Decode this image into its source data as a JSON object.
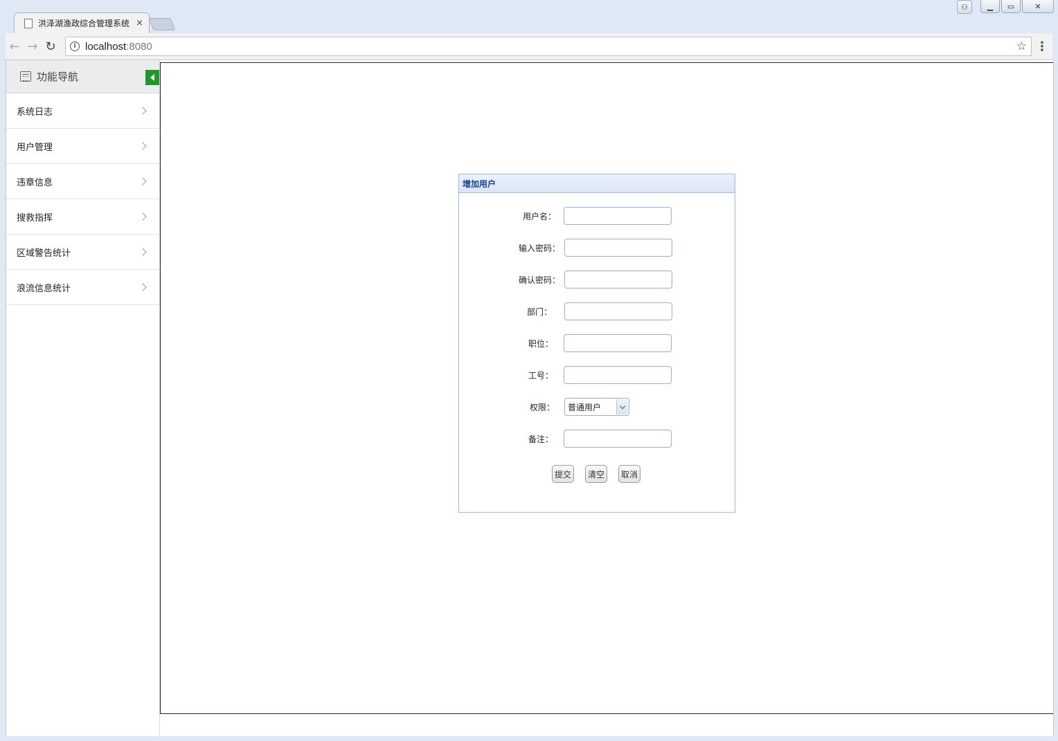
{
  "browser": {
    "tab_title": "洪泽湖渔政综合管理系统",
    "tab_close": "×",
    "url_host": "localhost",
    "url_port": ":8080"
  },
  "sidebar": {
    "title": "功能导航",
    "items": [
      {
        "label": "系统日志"
      },
      {
        "label": "用户管理"
      },
      {
        "label": "违章信息"
      },
      {
        "label": "搜救指挥"
      },
      {
        "label": "区域警告统计"
      },
      {
        "label": "浪流信息统计"
      }
    ]
  },
  "dialog": {
    "title": "增加用户",
    "fields": [
      {
        "label": "用户名：",
        "value": ""
      },
      {
        "label": "输入密码：",
        "value": ""
      },
      {
        "label": "确认密码：",
        "value": ""
      },
      {
        "label": "部门：",
        "value": ""
      },
      {
        "label": "职位：",
        "value": ""
      },
      {
        "label": "工号：",
        "value": ""
      },
      {
        "label": "权限：",
        "value": "普通用户"
      },
      {
        "label": "备注：",
        "value": ""
      }
    ],
    "buttons": {
      "submit": "提交",
      "clear": "清空",
      "cancel": "取消"
    }
  },
  "colors": {
    "collapse_button": "#1e9a2a",
    "dialog_border": "#99bbe8",
    "dialog_title": "#15428b"
  }
}
